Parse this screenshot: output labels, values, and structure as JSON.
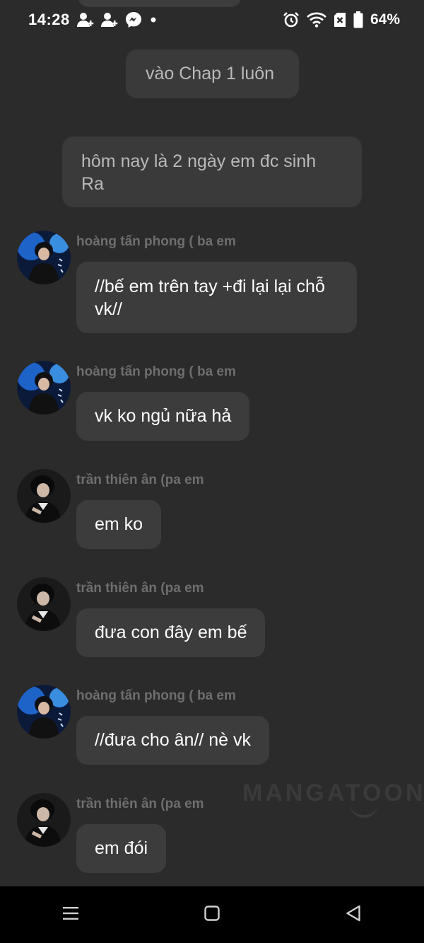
{
  "status_bar": {
    "time": "14:28",
    "battery_percent": "64%",
    "left_icons": [
      "person-add-icon",
      "person-add-icon",
      "messenger-icon",
      "dot-icon"
    ],
    "right_icons": [
      "alarm-icon",
      "wifi-icon",
      "sim-off-icon",
      "battery-icon"
    ]
  },
  "narrations": [
    "vào Chap 1 luôn",
    "hôm nay là 2 ngày em đc sinh Ra"
  ],
  "messages": [
    {
      "sender": "hoàng tấn phong ( ba em",
      "text": "//bế em trên tay +đi lại lại chỗ vk//",
      "avatar": "blue"
    },
    {
      "sender": "hoàng tấn phong ( ba em",
      "text": "vk ko ngủ nữa hả",
      "avatar": "blue"
    },
    {
      "sender": "trần thiên ân (pa em",
      "text": "em ko",
      "avatar": "dark"
    },
    {
      "sender": "trần thiên ân (pa em",
      "text": "đưa con đây em bế",
      "avatar": "dark"
    },
    {
      "sender": "hoàng tấn phong ( ba em",
      "text": "//đưa cho ân// nè vk",
      "avatar": "blue"
    },
    {
      "sender": "trần thiên ân (pa em",
      "text": "em đói",
      "avatar": "dark"
    }
  ],
  "watermark": "MANGATOON",
  "nav_bar": {
    "buttons": [
      "menu-icon",
      "home-square-icon",
      "back-triangle-icon"
    ]
  },
  "colors": {
    "background": "#2b2b2b",
    "bubble": "#3c3c3c",
    "narration_text": "#b9b9b9",
    "sender_text": "#6e6e6e",
    "nav_bar": "#000000"
  }
}
